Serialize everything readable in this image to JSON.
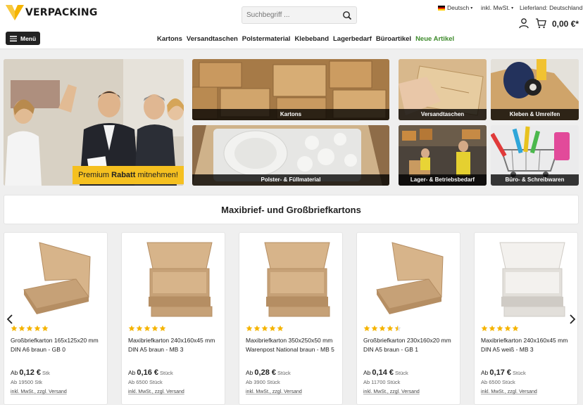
{
  "brand": {
    "name": "VERPACKING",
    "accent": "#f5b400"
  },
  "search": {
    "placeholder": "Suchbegriff ..."
  },
  "meta": {
    "language": "Deutsch",
    "tax_mode": "inkl. MwSt.",
    "delivery_label": "Lieferland:",
    "delivery_country": "Deutschland"
  },
  "cart": {
    "total": "0,00 €*"
  },
  "menu_label": "Menü",
  "nav": [
    "Kartons",
    "Versandtaschen",
    "Polstermaterial",
    "Klebeband",
    "Lagerbedarf",
    "Büroartikel",
    "Neue Artikel"
  ],
  "hero": {
    "promo_pre": "Premium",
    "promo_bold": "Rabatt",
    "promo_post": "mitnehmen!"
  },
  "categories": {
    "kartons": "Kartons",
    "versand": "Versandtaschen",
    "kleben": "Kleben & Umreifen",
    "polster": "Polster- & Füllmaterial",
    "lager": "Lager- & Betriebsbedarf",
    "buero": "Büro- & Schreibwaren"
  },
  "section_title": "Maxibrief- und Großbriefkartons",
  "products": [
    {
      "name": "Großbriefkarton 165x125x20 mm DIN A6 braun - GB 0",
      "price": "0,12 €",
      "unit": "Stk",
      "min_qty": "Ab 19500 Stk",
      "rating": 5,
      "color": "brown"
    },
    {
      "name": "Maxibriefkarton 240x160x45 mm DIN A5 braun - MB 3",
      "price": "0,16 €",
      "unit": "Stück",
      "min_qty": "Ab 6500 Stück",
      "rating": 5,
      "color": "brown"
    },
    {
      "name": "Maxibriefkarton 350x250x50 mm Warenpost National braun - MB 5",
      "price": "0,28 €",
      "unit": "Stück",
      "min_qty": "Ab 3900 Stück",
      "rating": 5,
      "color": "brown"
    },
    {
      "name": "Großbriefkarton 230x160x20 mm DIN A5 braun - GB 1",
      "price": "0,14 €",
      "unit": "Stück",
      "min_qty": "Ab 11700 Stück",
      "rating": 4.5,
      "color": "brown"
    },
    {
      "name": "Maxibriefkarton 240x160x45 mm DIN A5 weiß - MB 3",
      "price": "0,17 €",
      "unit": "Stück",
      "min_qty": "Ab 6500 Stück",
      "rating": 5,
      "color": "white"
    }
  ],
  "price_prefix": "Ab",
  "tax_note": "inkl. MwSt., zzgl. Versand",
  "colors": {
    "star": "#f5b400",
    "new_link": "#3d8a2b",
    "promo": "#f5c020"
  }
}
